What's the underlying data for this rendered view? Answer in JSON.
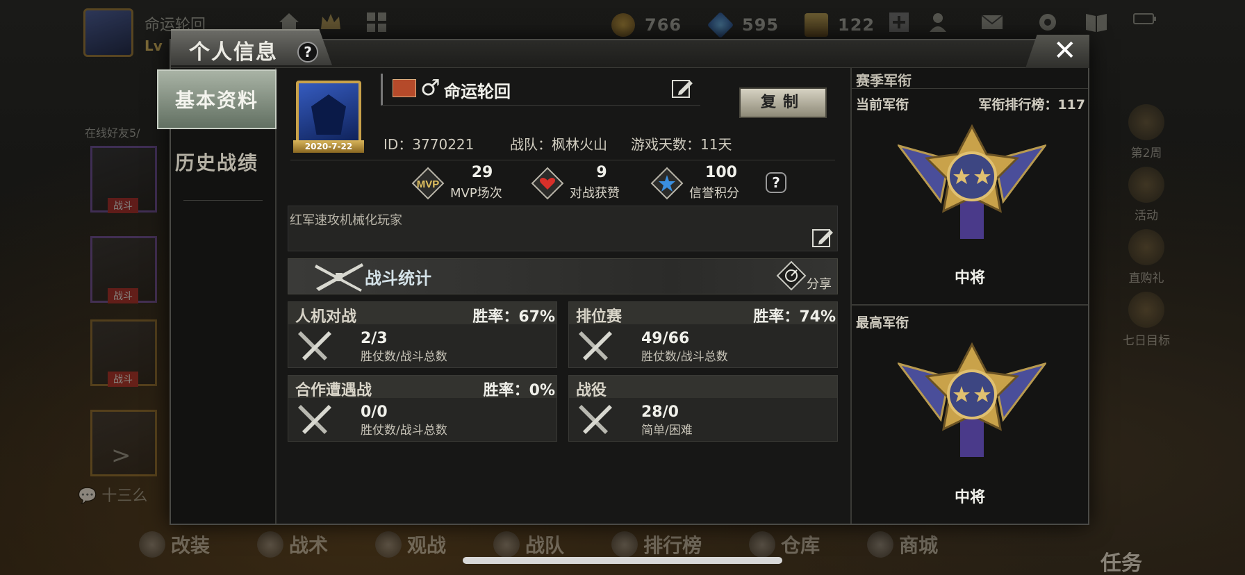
{
  "top_bar": {
    "player_name": "命运轮回",
    "level_prefix": "Lv",
    "gold": "766",
    "diamonds": "595",
    "tickets": "122"
  },
  "background_left": {
    "online_friends": "在线好友5/",
    "battle_tag": "战斗",
    "chat_preview": "十三么"
  },
  "background_right": {
    "items": [
      "第2周",
      "活动",
      "直购礼",
      "七日目标"
    ]
  },
  "bottom_nav": {
    "items": [
      "改装",
      "战术",
      "观战",
      "战队",
      "排行榜",
      "仓库",
      "商城"
    ],
    "task": "任务"
  },
  "modal": {
    "title": "个人信息",
    "help": "?",
    "close": "✕",
    "tabs": [
      "基本资料",
      "历史战绩"
    ]
  },
  "profile": {
    "avatar_date": "2020-7-22",
    "gender_symbol": "♂",
    "name": "命运轮回",
    "copy_button": "复制",
    "id": "ID：3770221",
    "team": "战队：枫林火山",
    "days": "游戏天数：11天",
    "signature": "红军速攻机械化玩家"
  },
  "stats": [
    {
      "value": "29",
      "label": "MVP场次",
      "icon": "mvp-icon"
    },
    {
      "value": "9",
      "label": "对战获赞",
      "icon": "heart-icon"
    },
    {
      "value": "100",
      "label": "信誉积分",
      "icon": "star-icon"
    }
  ],
  "battle_stats": {
    "title": "战斗统计",
    "share": "分享",
    "cards": [
      {
        "mode": "人机对战",
        "rate": "胜率：67%",
        "value": "2/3",
        "sub": "胜仗数/战斗总数"
      },
      {
        "mode": "排位赛",
        "rate": "胜率：74%",
        "value": "49/66",
        "sub": "胜仗数/战斗总数"
      },
      {
        "mode": "合作遭遇战",
        "rate": "胜率：0%",
        "value": "0/0",
        "sub": "胜仗数/战斗总数"
      },
      {
        "mode": "战役",
        "rate": "",
        "value": "28/0",
        "sub": "简单/困难"
      }
    ]
  },
  "rank_panel": {
    "title": "赛季军衔",
    "current_label": "当前军衔",
    "leaderboard": "军衔排行榜：117",
    "current_rank": "中将",
    "highest_label": "最高军衔",
    "highest_rank": "中将"
  },
  "colors": {
    "accent_gold": "#c9a24a",
    "heart_red": "#d8302a",
    "star_blue": "#3a8fe0",
    "medal_blue": "#4a4e9a"
  }
}
